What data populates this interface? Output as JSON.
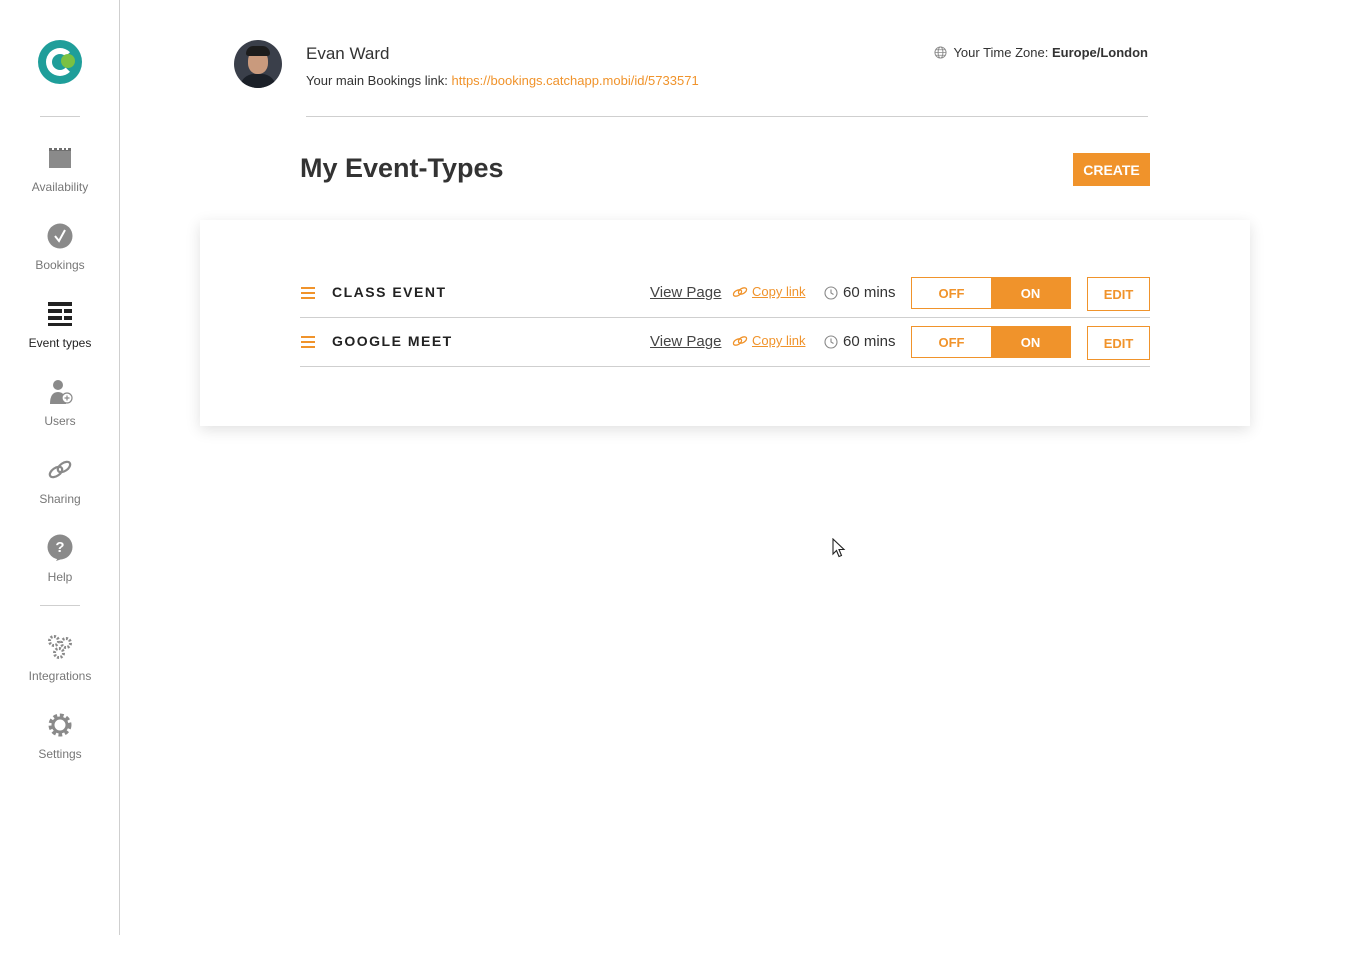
{
  "sidebar": {
    "items": [
      {
        "label": "Availability",
        "icon": "calendar-icon"
      },
      {
        "label": "Bookings",
        "icon": "check-circle-icon"
      },
      {
        "label": "Event types",
        "icon": "event-list-icon",
        "active": true
      },
      {
        "label": "Users",
        "icon": "add-user-icon"
      },
      {
        "label": "Sharing",
        "icon": "link-icon"
      },
      {
        "label": "Help",
        "icon": "help-icon"
      },
      {
        "label": "Integrations",
        "icon": "gears-icon"
      },
      {
        "label": "Settings",
        "icon": "settings-gear-icon"
      }
    ]
  },
  "header": {
    "user_name": "Evan Ward",
    "link_label": "Your main Bookings link: ",
    "link_url": "https://bookings.catchapp.mobi/id/5733571",
    "timezone_label": "Your Time Zone: ",
    "timezone_value": "Europe/London"
  },
  "main": {
    "title": "My Event-Types",
    "create_label": "CREATE"
  },
  "events": [
    {
      "name": "CLASS EVENT",
      "view_label": "View Page",
      "copy_label": "Copy link",
      "duration": "60 mins",
      "off_label": "OFF",
      "on_label": "ON",
      "edit_label": "EDIT",
      "state": "on"
    },
    {
      "name": "GOOGLE MEET",
      "view_label": "View Page",
      "copy_label": "Copy link",
      "duration": "60 mins",
      "off_label": "OFF",
      "on_label": "ON",
      "edit_label": "EDIT",
      "state": "on"
    }
  ],
  "colors": {
    "accent": "#f0932b",
    "brand_teal": "#1f9e9a",
    "brand_green": "#7ac143"
  }
}
